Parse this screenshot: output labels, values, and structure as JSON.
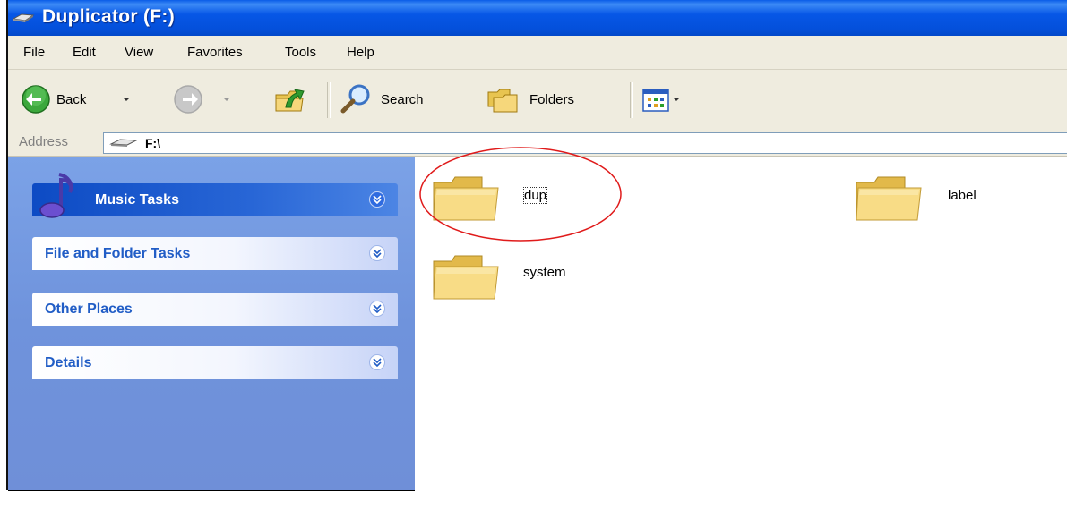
{
  "window": {
    "title": "Duplicator (F:)"
  },
  "menu": [
    "File",
    "Edit",
    "View",
    "Favorites",
    "Tools",
    "Help"
  ],
  "toolbar": {
    "back": "Back",
    "search": "Search",
    "folders": "Folders"
  },
  "address": {
    "label": "Address",
    "value": "F:\\"
  },
  "left_panels": [
    "Music Tasks",
    "File and Folder Tasks",
    "Other Places",
    "Details"
  ],
  "items": [
    {
      "name": "dup",
      "selected_focus": true,
      "annotated": true
    },
    {
      "name": "label"
    },
    {
      "name": "system"
    }
  ],
  "colors": {
    "titlebar": "#0757e6",
    "folder_yellow": "#f6d77b",
    "annotation_red": "#e01b1b",
    "panel_text": "#215dc6"
  }
}
